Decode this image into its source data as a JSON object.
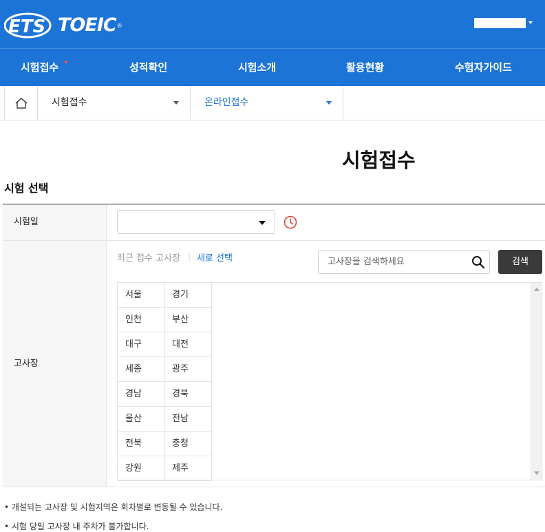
{
  "header": {
    "logo_ets": "ETS",
    "logo_toeic": "TOEIC",
    "user_menu_icon": "chevron-down-icon"
  },
  "nav": {
    "items": [
      {
        "label": "시험접수",
        "active_dot": true
      },
      {
        "label": "성적확인"
      },
      {
        "label": "시험소개"
      },
      {
        "label": "활용현황"
      },
      {
        "label": "수험자가이드"
      }
    ]
  },
  "breadcrumb": {
    "home_icon": "home-icon",
    "level1": "시험접수",
    "level2": "온라인접수"
  },
  "page": {
    "title": "시험접수",
    "section_title": "시험 선택"
  },
  "form": {
    "date_label": "시험일",
    "date_value": "",
    "date_icon": "clock-icon",
    "venue_label": "고사장",
    "recent_link": "최근 접수 고사장",
    "separator": "|",
    "new_select_link": "새로 선택",
    "search_placeholder": "고사장을 검색하세요",
    "search_button": "검색",
    "regions": [
      "서울",
      "경기",
      "인천",
      "부산",
      "대구",
      "대전",
      "세종",
      "광주",
      "경남",
      "경북",
      "울산",
      "전남",
      "전북",
      "충청",
      "강원",
      "제주"
    ]
  },
  "notes": [
    "• 개설되는 고사장 및 시험지역은 회차별로 변동될 수 있습니다.",
    "• 시험 당일 고사장 내 주차가 불가합니다."
  ],
  "colors": {
    "brand_blue": "#1b74d6",
    "alert_red": "#e0453a",
    "button_dark": "#3a3a3a"
  }
}
